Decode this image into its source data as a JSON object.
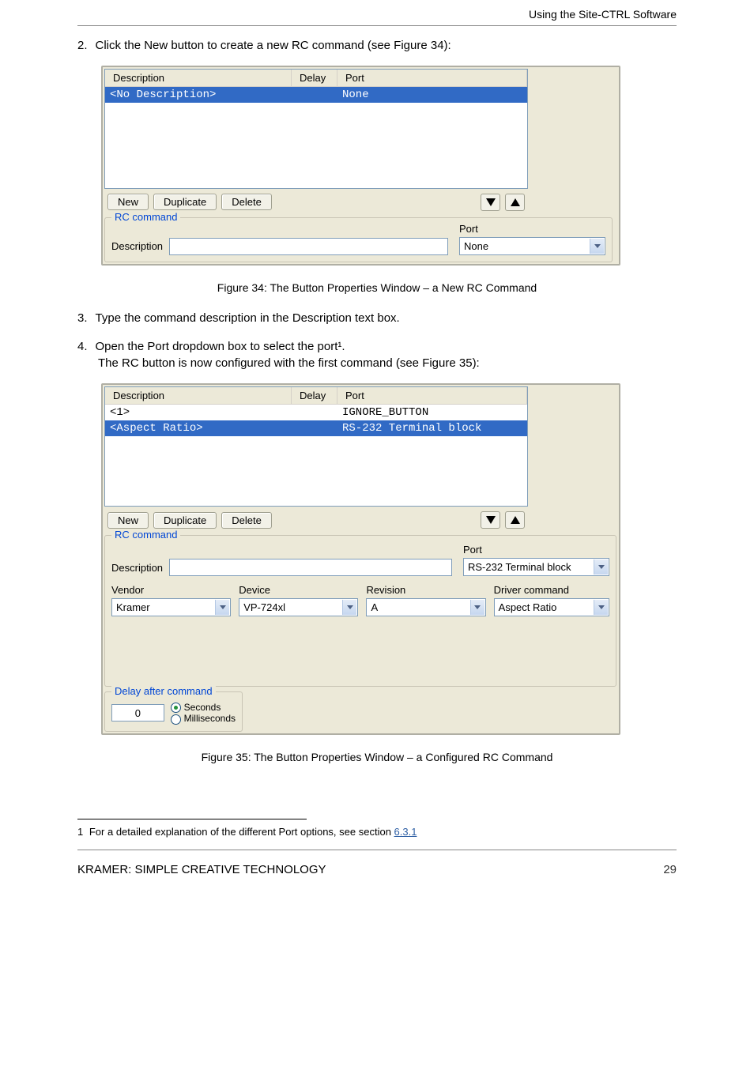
{
  "header_right": "Using the Site-CTRL Software",
  "topline": {
    "num": "2.",
    "text": "Click the New button to create a new RC command (see Figure 34):"
  },
  "fig7": {
    "table": {
      "headers": {
        "description": "Description",
        "delay": "Delay",
        "port": "Port"
      },
      "rows": [
        {
          "description": "<No Description>",
          "delay": "",
          "port": "None",
          "selected": true
        }
      ],
      "buttons": {
        "new": "New",
        "duplicate": "Duplicate",
        "delete": "Delete"
      }
    },
    "rc": {
      "legend": "RC command",
      "desc_label": "Description",
      "port_label": "Port",
      "port_value": "None"
    }
  },
  "caption7": {
    "no": "Figure 34",
    "title": ": The Button Properties Window – a New RC Command"
  },
  "mid1": {
    "num": "3.",
    "text": "Type the command description in the Description text box."
  },
  "mid2": {
    "num": "4.",
    "text_full": "Open the Port dropdown box to select the port¹.",
    "text_before_break": "The RC button is now configured with the first command (see ",
    "figref": "Figure 35",
    "text_after": "):"
  },
  "fig8": {
    "table": {
      "headers": {
        "description": "Description",
        "delay": "Delay",
        "port": "Port"
      },
      "rows": [
        {
          "description": "<1>",
          "delay": "",
          "port": "IGNORE_BUTTON",
          "selected": false
        },
        {
          "description": "<Aspect Ratio>",
          "delay": "",
          "port": "RS-232 Terminal block",
          "selected": true
        }
      ],
      "buttons": {
        "new": "New",
        "duplicate": "Duplicate",
        "delete": "Delete"
      }
    },
    "rc": {
      "legend": "RC command",
      "desc_label": "Description",
      "port_label": "Port",
      "port_value": "RS-232 Terminal block",
      "vendor_label": "Vendor",
      "vendor_value": "Kramer",
      "device_label": "Device",
      "device_value": "VP-724xl",
      "revision_label": "Revision",
      "revision_value": "A",
      "drivercmd_label": "Driver command",
      "drivercmd_value": "Aspect Ratio"
    },
    "delay": {
      "legend": "Delay after command",
      "value": "0",
      "opt_seconds": "Seconds",
      "opt_ms": "Milliseconds"
    }
  },
  "caption8": {
    "no": "Figure 35",
    "title": ": The Button Properties Window – a Configured RC Command"
  },
  "footnote": {
    "num": "1",
    "text_before": "For a detailed explanation of the different Port options, see section ",
    "link": "6.3.1"
  },
  "footer": {
    "left": "KRAMER: SIMPLE CREATIVE TECHNOLOGY",
    "right": "29"
  }
}
